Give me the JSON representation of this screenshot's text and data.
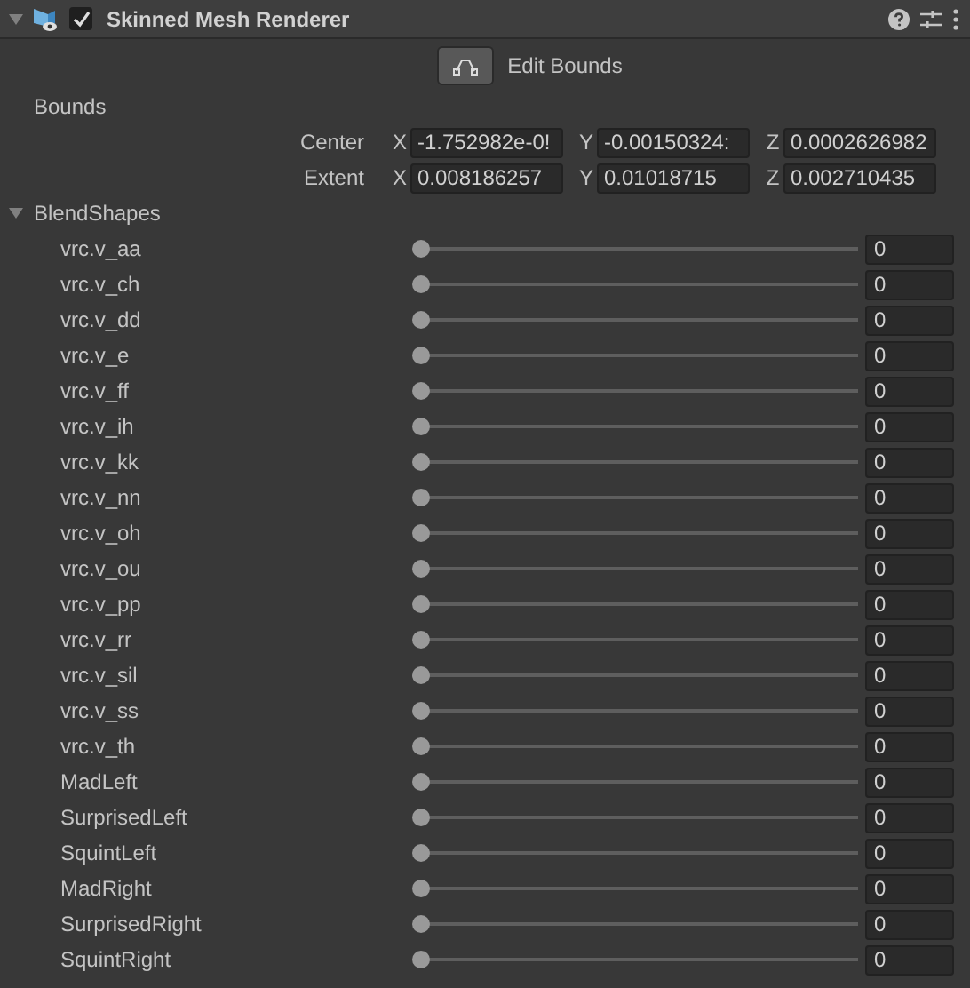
{
  "component": {
    "title": "Skinned Mesh Renderer",
    "enabled": true,
    "expanded": true
  },
  "edit_button": {
    "label": "Edit Bounds"
  },
  "bounds": {
    "label": "Bounds",
    "rows": [
      {
        "label": "Center",
        "fields": [
          {
            "axis": "X",
            "value": "-1.752982e-0!"
          },
          {
            "axis": "Y",
            "value": "-0.00150324:"
          },
          {
            "axis": "Z",
            "value": "0.0002626982"
          }
        ]
      },
      {
        "label": "Extent",
        "fields": [
          {
            "axis": "X",
            "value": "0.008186257"
          },
          {
            "axis": "Y",
            "value": "0.01018715"
          },
          {
            "axis": "Z",
            "value": "0.002710435"
          }
        ]
      }
    ]
  },
  "blendshapes": {
    "label": "BlendShapes",
    "expanded": true,
    "items": [
      {
        "name": "vrc.v_aa",
        "level": 0,
        "value": "0"
      },
      {
        "name": "vrc.v_ch",
        "level": 0,
        "value": "0"
      },
      {
        "name": "vrc.v_dd",
        "level": 0,
        "value": "0"
      },
      {
        "name": "vrc.v_e",
        "level": 0,
        "value": "0"
      },
      {
        "name": "vrc.v_ff",
        "level": 0,
        "value": "0"
      },
      {
        "name": "vrc.v_ih",
        "level": 0,
        "value": "0"
      },
      {
        "name": "vrc.v_kk",
        "level": 0,
        "value": "0"
      },
      {
        "name": "vrc.v_nn",
        "level": 0,
        "value": "0"
      },
      {
        "name": "vrc.v_oh",
        "level": 0,
        "value": "0"
      },
      {
        "name": "vrc.v_ou",
        "level": 0,
        "value": "0"
      },
      {
        "name": "vrc.v_pp",
        "level": 0,
        "value": "0"
      },
      {
        "name": "vrc.v_rr",
        "level": 0,
        "value": "0"
      },
      {
        "name": "vrc.v_sil",
        "level": 0,
        "value": "0"
      },
      {
        "name": "vrc.v_ss",
        "level": 0,
        "value": "0"
      },
      {
        "name": "vrc.v_th",
        "level": 0,
        "value": "0"
      },
      {
        "name": "MadLeft",
        "level": 0,
        "value": "0"
      },
      {
        "name": "SurprisedLeft",
        "level": 0,
        "value": "0"
      },
      {
        "name": "SquintLeft",
        "level": 0,
        "value": "0"
      },
      {
        "name": "MadRight",
        "level": 0,
        "value": "0"
      },
      {
        "name": "SurprisedRight",
        "level": 0,
        "value": "0"
      },
      {
        "name": "SquintRight",
        "level": 0,
        "value": "0"
      }
    ]
  }
}
